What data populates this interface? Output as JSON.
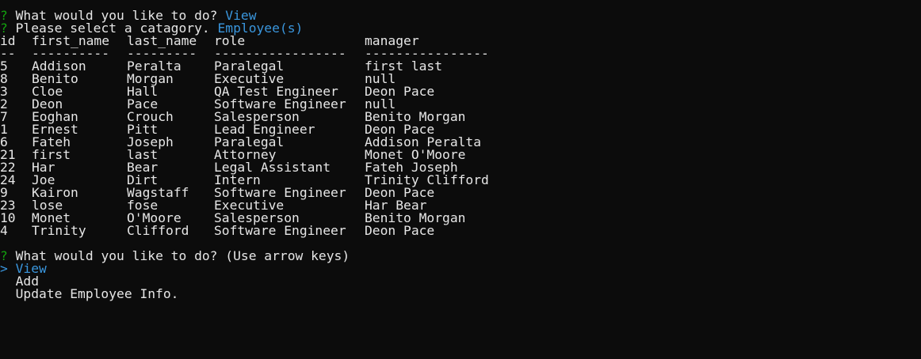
{
  "prompts": {
    "q1_mark": "?",
    "q1_text": "What would you like to do? ",
    "q1_answer": "View",
    "q2_mark": "?",
    "q2_text": "Please select a catagory. ",
    "q2_answer": "Employee(s)",
    "q3_mark": "?",
    "q3_text": "What would you like to do? (Use arrow keys)"
  },
  "table": {
    "headers": [
      "id",
      "first_name",
      "last_name",
      "role",
      "manager"
    ],
    "separators": [
      "--",
      "----------",
      "---------",
      "-----------------",
      "----------------"
    ],
    "rows": [
      [
        "5",
        "Addison",
        "Peralta",
        "Paralegal",
        "first last"
      ],
      [
        "8",
        "Benito",
        "Morgan",
        "Executive",
        "null"
      ],
      [
        "3",
        "Cloe",
        "Hall",
        "QA Test Engineer",
        "Deon Pace"
      ],
      [
        "2",
        "Deon",
        "Pace",
        "Software Engineer",
        "null"
      ],
      [
        "7",
        "Eoghan",
        "Crouch",
        "Salesperson",
        "Benito Morgan"
      ],
      [
        "1",
        "Ernest",
        "Pitt",
        "Lead Engineer",
        "Deon Pace"
      ],
      [
        "6",
        "Fateh",
        "Joseph",
        "Paralegal",
        "Addison Peralta"
      ],
      [
        "21",
        "first",
        "last",
        "Attorney",
        "Monet O'Moore"
      ],
      [
        "22",
        "Har",
        "Bear",
        "Legal Assistant",
        "Fateh Joseph"
      ],
      [
        "24",
        "Joe",
        "Dirt",
        "Intern",
        "Trinity Clifford"
      ],
      [
        "9",
        "Kairon",
        "Wagstaff",
        "Software Engineer",
        "Deon Pace"
      ],
      [
        "23",
        "lose",
        "fose",
        "Executive",
        "Har Bear"
      ],
      [
        "10",
        "Monet",
        "O'Moore",
        "Salesperson",
        "Benito Morgan"
      ],
      [
        "4",
        "Trinity",
        "Clifford",
        "Software Engineer",
        "Deon Pace"
      ]
    ]
  },
  "menu": {
    "pointer": ">",
    "options": [
      "View",
      "Add",
      "Update Employee Info."
    ],
    "selected_index": 0
  },
  "colors": {
    "background": "#0c0c0c",
    "text": "#e6e6e6",
    "prompt_mark": "#13a10e",
    "answer": "#3a96dd"
  }
}
